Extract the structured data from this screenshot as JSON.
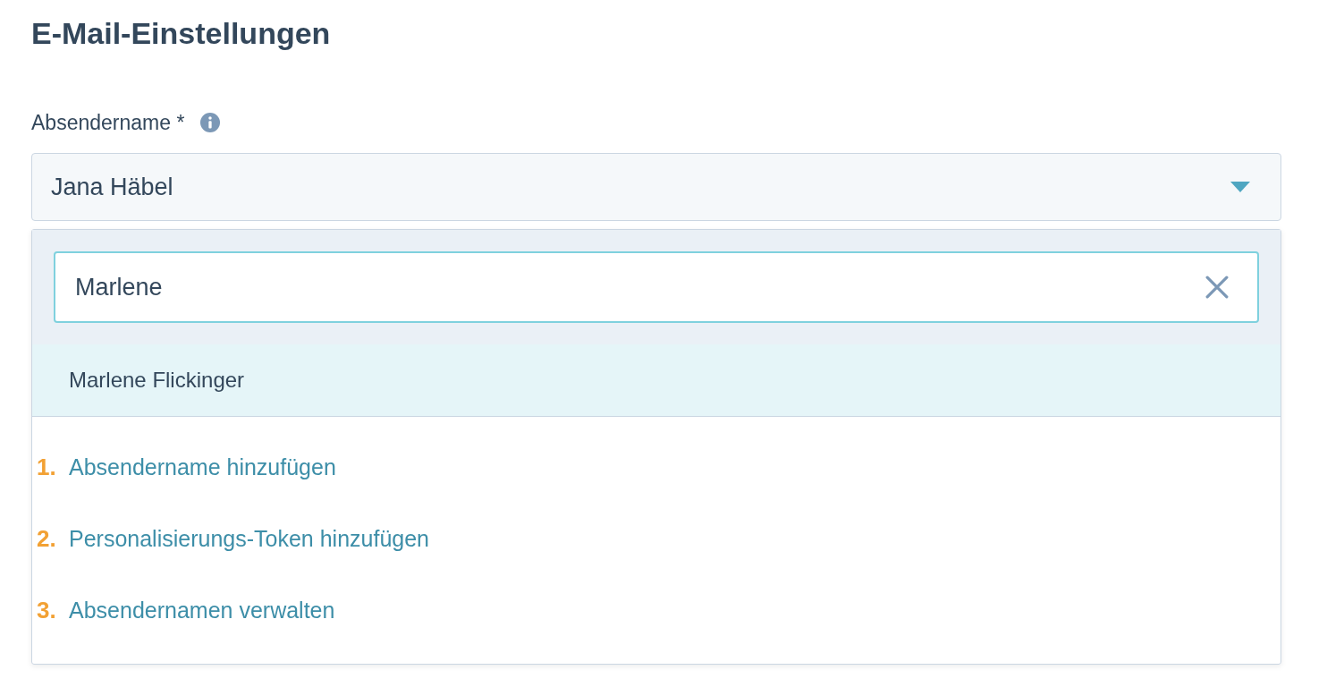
{
  "heading": "E-Mail-Einstellungen",
  "field": {
    "label": "Absendername *",
    "value": "Jana Häbel",
    "expanded": true
  },
  "search": {
    "value": "Marlene"
  },
  "options": [
    {
      "label": "Marlene Flickinger",
      "selected": true
    }
  ],
  "actions": [
    {
      "number": "1.",
      "label": "Absendername hinzufügen"
    },
    {
      "number": "2.",
      "label": "Personalisierungs-Token hinzufügen"
    },
    {
      "number": "3.",
      "label": "Absendernamen verwalten"
    }
  ]
}
